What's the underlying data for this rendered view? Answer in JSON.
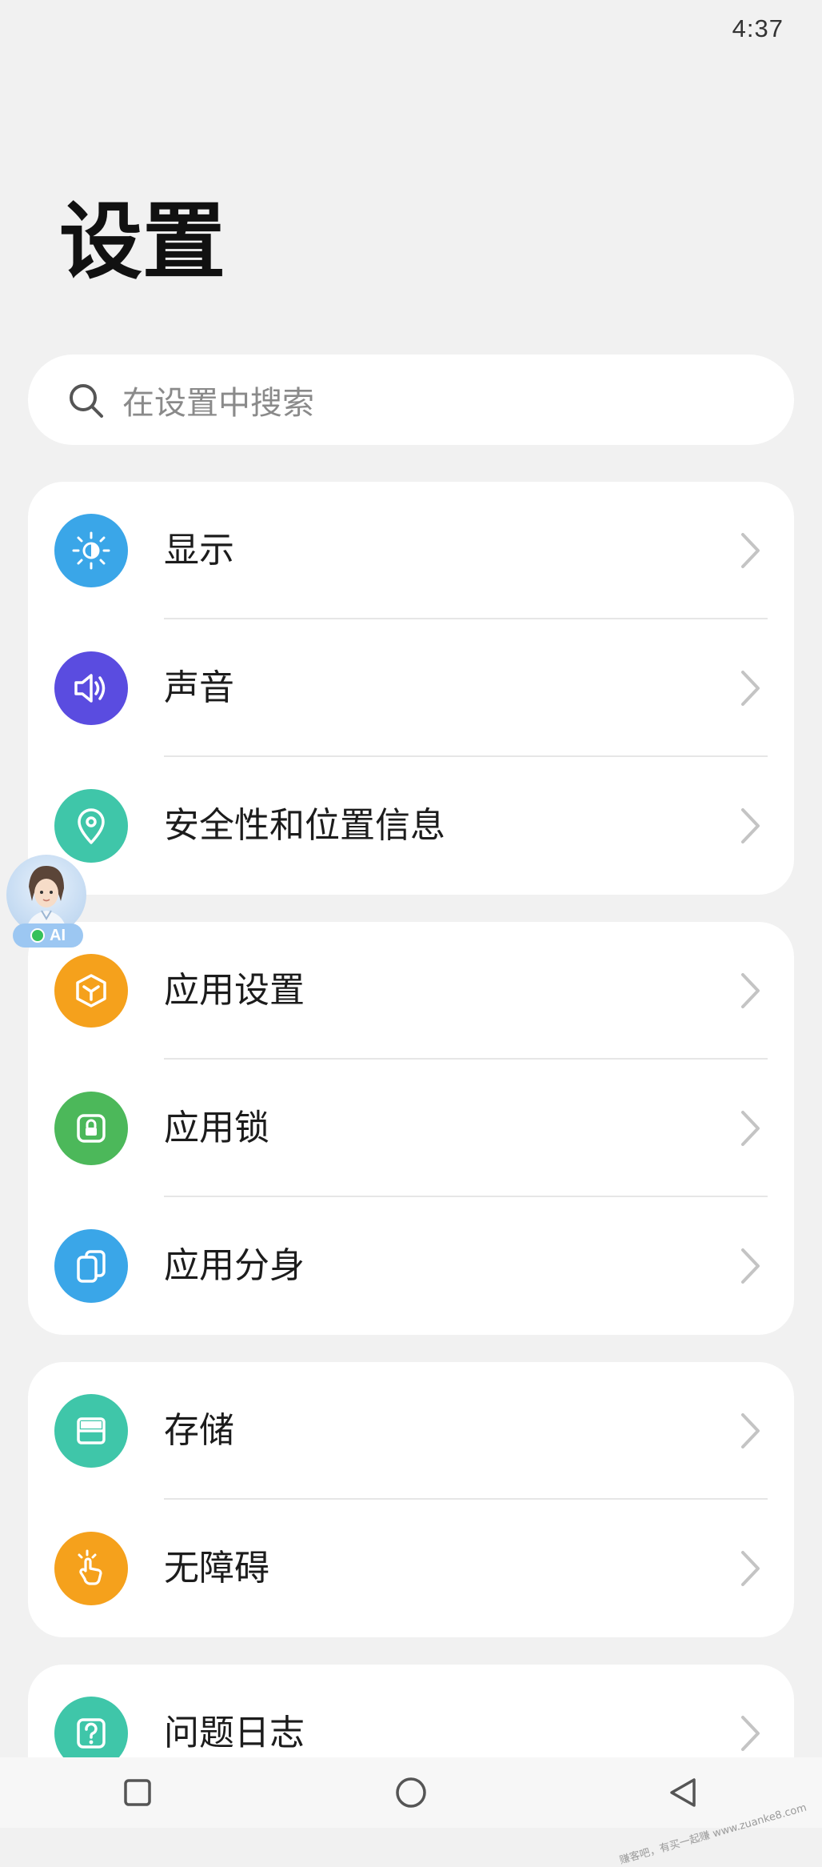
{
  "status_bar": {
    "time": "4:37"
  },
  "page": {
    "title": "设置"
  },
  "search": {
    "placeholder": "在设置中搜索"
  },
  "groups": [
    {
      "items": [
        {
          "label": "显示",
          "icon": "brightness-icon",
          "color": "#3aa6e8"
        },
        {
          "label": "声音",
          "icon": "speaker-icon",
          "color": "#5a4ce0"
        },
        {
          "label": "安全性和位置信息",
          "icon": "location-icon",
          "color": "#3fc6a9"
        }
      ]
    },
    {
      "items": [
        {
          "label": "应用设置",
          "icon": "cube-icon",
          "color": "#f5a11c"
        },
        {
          "label": "应用锁",
          "icon": "lock-icon",
          "color": "#4cb85a"
        },
        {
          "label": "应用分身",
          "icon": "clone-icon",
          "color": "#3aa6e8"
        }
      ]
    },
    {
      "items": [
        {
          "label": "存储",
          "icon": "storage-icon",
          "color": "#3fc6a9"
        },
        {
          "label": "无障碍",
          "icon": "hand-touch-icon",
          "color": "#f5a11c"
        }
      ]
    },
    {
      "items": [
        {
          "label": "问题日志",
          "icon": "question-icon",
          "color": "#3fc6a9"
        }
      ]
    }
  ],
  "assistant": {
    "badge": "AI",
    "icon": "assistant-avatar-icon"
  },
  "nav": {
    "recents_icon": "square-icon",
    "home_icon": "circle-icon",
    "back_icon": "triangle-back-icon"
  },
  "watermark": {
    "text": "赚客吧，有买一起赚 www.zuanke8.com"
  }
}
